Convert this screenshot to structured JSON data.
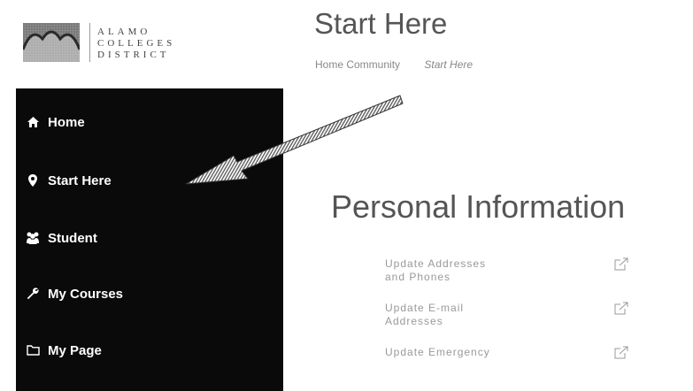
{
  "brand": {
    "logo_lines": [
      "ALAMO",
      "COLLEGES",
      "DISTRICT"
    ],
    "dark": "#0a0a0a",
    "text_gray": "#555555"
  },
  "header": {
    "title": "Start Here",
    "breadcrumb": [
      "Home Community",
      "Start Here"
    ]
  },
  "sidebar": {
    "items": [
      {
        "label": "Home",
        "icon": "home-icon"
      },
      {
        "label": "Start Here",
        "icon": "map-pin-icon"
      },
      {
        "label": "Student",
        "icon": "users-icon"
      },
      {
        "label": "My Courses",
        "icon": "wrench-icon"
      },
      {
        "label": "My Page",
        "icon": "folder-icon"
      }
    ]
  },
  "personal": {
    "title": "Personal Information",
    "links": [
      {
        "label": "Update Addresses and Phones",
        "icon": "external-link-icon"
      },
      {
        "label": "Update E-mail Addresses",
        "icon": "external-link-icon"
      },
      {
        "label": "Update Emergency",
        "icon": "external-link-icon"
      }
    ]
  }
}
